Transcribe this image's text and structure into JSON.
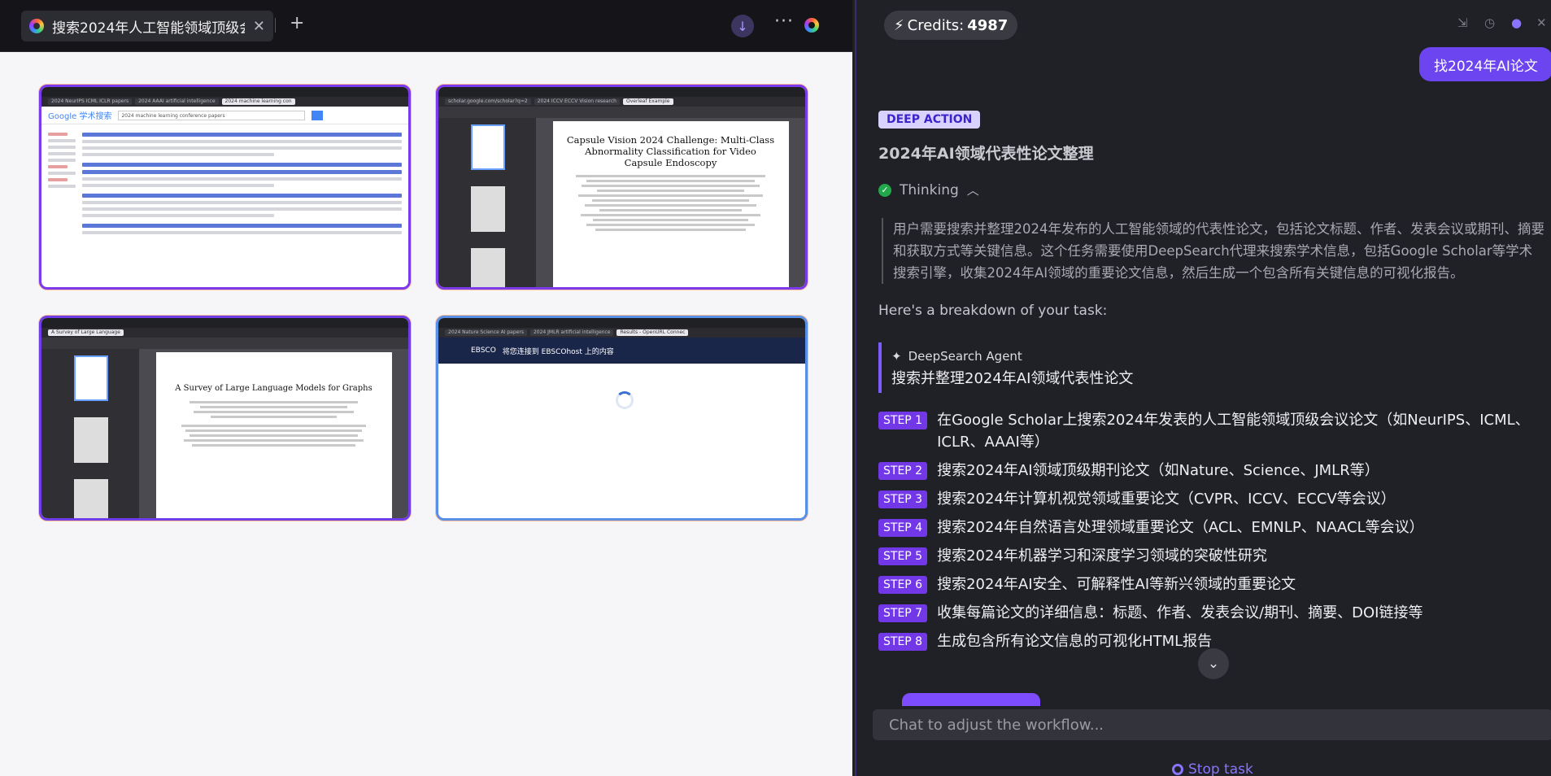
{
  "browser": {
    "tab_title": "搜索2024年人工智能领域顶级会",
    "tab_close": "✕",
    "new_tab": "+",
    "more": "···"
  },
  "thumbs": {
    "t1": {
      "tabs": [
        "2024 NeurIPS ICML ICLR papers",
        "2024 AAAI artificial intelligence",
        "2024 machine learning con"
      ],
      "search_query": "2024 machine learning conference papers",
      "logo": "Google 学术搜索"
    },
    "t2": {
      "tabs": [
        "scholar.google.com/scholar?q=2",
        "2024 ICCV ECCV Vision research",
        "Overleaf Example"
      ],
      "paper_title": "Capsule Vision 2024 Challenge: Multi-Class Abnormality Classification for Video Capsule Endoscopy"
    },
    "t3": {
      "tabs": [
        "A Survey of Large Language"
      ],
      "paper_title": "A Survey of Large Language Models for Graphs"
    },
    "t4": {
      "tabs": [
        "2024 Nature Science AI papers",
        "2024 JMLR artificial intelligence",
        "Results - OpenURL Connec"
      ],
      "logo": "EBSCO",
      "notice": "将您连接到 EBSCOhost 上的内容"
    }
  },
  "assistant": {
    "credits_label": "Credits:",
    "credits_value": "4987",
    "user_message": "找2024年AI论文",
    "badge": "DEEP ACTION",
    "response_title": "2024年AI领域代表性论文整理",
    "thinking_label": "Thinking",
    "thinking_text": "用户需要搜索并整理2024年发布的人工智能领域的代表性论文，包括论文标题、作者、发表会议或期刊、摘要和获取方式等关键信息。这个任务需要使用DeepSearch代理来搜索学术信息，包括Google Scholar等学术搜索引擎，收集2024年AI领域的重要论文信息，然后生成一个包含所有关键信息的可视化报告。",
    "breakdown": "Here's a breakdown of your task:",
    "agent_name": "DeepSearch Agent",
    "agent_task": "搜索并整理2024年AI领域代表性论文",
    "steps": [
      {
        "tag": "STEP 1",
        "text": "在Google Scholar上搜索2024年发表的人工智能领域顶级会议论文（如NeurIPS、ICML、ICLR、AAAI等）"
      },
      {
        "tag": "STEP 2",
        "text": "搜索2024年AI领域顶级期刊论文（如Nature、Science、JMLR等）"
      },
      {
        "tag": "STEP 3",
        "text": "搜索2024年计算机视觉领域重要论文（CVPR、ICCV、ECCV等会议）"
      },
      {
        "tag": "STEP 4",
        "text": "搜索2024年自然语言处理领域重要论文（ACL、EMNLP、NAACL等会议）"
      },
      {
        "tag": "STEP 5",
        "text": "搜索2024年机器学习和深度学习领域的突破性研究"
      },
      {
        "tag": "STEP 6",
        "text": "搜索2024年AI安全、可解释性AI等新兴领域的重要论文"
      },
      {
        "tag": "STEP 7",
        "text": "收集每篇论文的详细信息：标题、作者、发表会议/期刊、摘要、DOI链接等"
      },
      {
        "tag": "STEP 8",
        "text": "生成包含所有论文信息的可视化HTML报告"
      }
    ],
    "chat_placeholder": "Chat to adjust the workflow...",
    "stop_label": "Stop task"
  }
}
